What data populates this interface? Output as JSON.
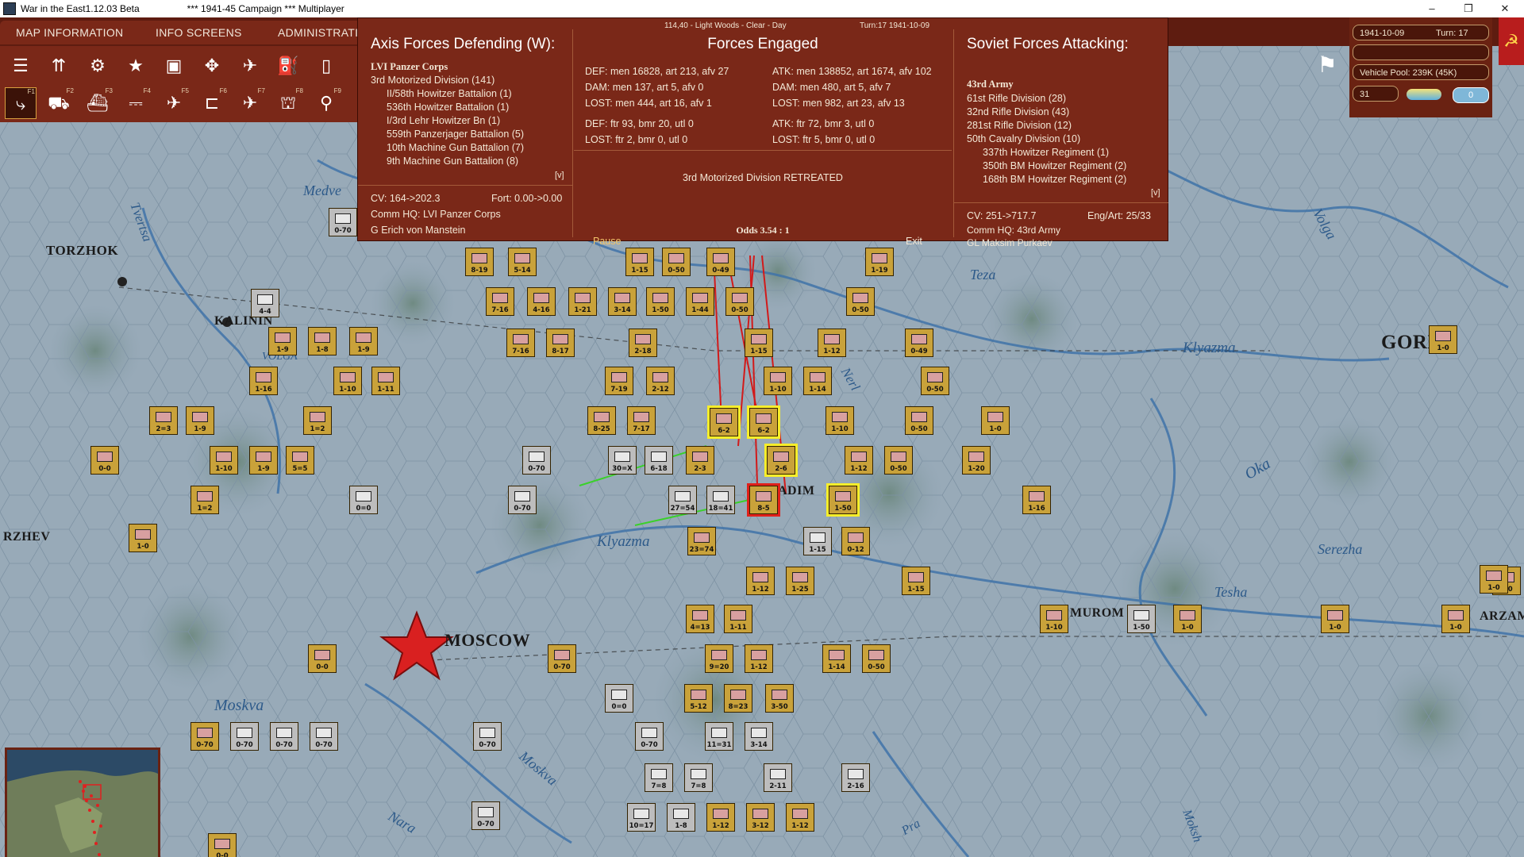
{
  "window": {
    "title": "War in the East1.12.03 Beta",
    "subtitle": "***   1941-45 Campaign   ***   Multiplayer",
    "minimize": "–",
    "maximize": "❐",
    "close": "✕"
  },
  "tabs": [
    {
      "label": "MAP INFORMATION"
    },
    {
      "label": "INFO SCREENS"
    },
    {
      "label": "ADMINISTRATI"
    }
  ],
  "toolbar": {
    "row1_icons": [
      "layers-icon",
      "units-icon",
      "gear-icon",
      "star-icon",
      "hq-icon",
      "arrows-icon",
      "bombers-icon",
      "fuel-icon",
      "report-icon"
    ],
    "row2_keys": [
      "F1",
      "F2",
      "F3",
      "F4",
      "F5",
      "F6",
      "F7",
      "F8",
      "F9"
    ]
  },
  "status": {
    "date": "1941-10-09",
    "turn": "Turn: 17",
    "vehicle_pool": "Vehicle Pool: 239K (45K)",
    "field_31": "31",
    "field_0": "0"
  },
  "combat": {
    "header_location": "114,40 - Light Woods - Clear - Day",
    "header_turn": "Turn:17  1941-10-09",
    "defender": {
      "title": "Axis Forces Defending (W):",
      "corps": "LVI Panzer Corps",
      "units": [
        "3rd Motorized Division (141)",
        "II/58th Howitzer Battalion (1)",
        "536th Howitzer Battalion (1)",
        "I/3rd Lehr Howitzer Bn (1)",
        "559th Panzerjager Battalion (5)",
        "10th Machine Gun Battalion (7)",
        "9th Machine Gun Battalion (8)"
      ],
      "toggle": "[v]",
      "cv": "CV: 164->202.3",
      "fort": "Fort: 0.00->0.00",
      "hq": "Comm HQ: LVI Panzer Corps",
      "leader": "G Erich von Manstein"
    },
    "engaged": {
      "title": "Forces Engaged",
      "def": "DEF: men 16828, art 213, afv 27",
      "dam_def": "DAM: men 137, art 5, afv 0",
      "lost_def": "LOST: men 444, art 16, afv 1",
      "def_air": "DEF: ftr 93, bmr 20, utl 0",
      "lost_def_air": "LOST: ftr 2, bmr 0, utl 0",
      "atk": "ATK: men 138852, art 1674, afv 102",
      "dam_atk": "DAM: men 480, art 5, afv 7",
      "lost_atk": "LOST: men 982, art 23, afv 13",
      "atk_air": "ATK: ftr 72, bmr 3, utl 0",
      "lost_atk_air": "LOST: ftr 5, bmr 0, utl 0",
      "result": "3rd Motorized Division RETREATED",
      "odds": "Odds 3.54 : 1",
      "pause": "Pause",
      "exit": "Exit"
    },
    "attacker": {
      "title": "Soviet Forces Attacking:",
      "army": "43rd Army",
      "units": [
        "61st Rifle Division (28)",
        "32nd Rifle Division (43)",
        "281st Rifle Division (12)",
        "50th Cavalry Division (10)",
        "337th Howitzer Regiment (1)",
        "350th BM Howitzer Regiment (2)",
        "168th BM Howitzer Regiment (2)"
      ],
      "toggle": "[v]",
      "cv": "CV: 251->717.7",
      "engart": "Eng/Art: 25/33",
      "hq": "Comm HQ: 43rd Army",
      "leader": "GL Maksim Purkaev"
    }
  },
  "map": {
    "cities": [
      "TORZHOK",
      "KALININ",
      "RZHEV",
      "MOSCOW",
      "GORKY",
      "MUROM",
      "ARZAM",
      "ADIM"
    ],
    "rivers": [
      "Medve",
      "Tvertsa",
      "VOLGA",
      "Teza",
      "Klyazma",
      "Klyazma",
      "Nerl",
      "Volga",
      "Oka",
      "Serezha",
      "Tesha",
      "Moskva",
      "Moskva",
      "Nara",
      "Pra",
      "Moksh"
    ]
  },
  "counters": [
    {
      "lbl": "0-70"
    },
    {
      "lbl": "8-19"
    },
    {
      "lbl": "5-14"
    },
    {
      "lbl": "1-15"
    },
    {
      "lbl": "0-50"
    },
    {
      "lbl": "0-49"
    },
    {
      "lbl": "1-19"
    },
    {
      "lbl": "4-4"
    },
    {
      "lbl": "7-16"
    },
    {
      "lbl": "4-16"
    },
    {
      "lbl": "1-21"
    },
    {
      "lbl": "3-14"
    },
    {
      "lbl": "1-50"
    },
    {
      "lbl": "1-44"
    },
    {
      "lbl": "0-50"
    },
    {
      "lbl": "0-50"
    },
    {
      "lbl": "1-9"
    },
    {
      "lbl": "1-8"
    },
    {
      "lbl": "1-9"
    },
    {
      "lbl": "7-16"
    },
    {
      "lbl": "8-17"
    },
    {
      "lbl": "2-18"
    },
    {
      "lbl": "1-15"
    },
    {
      "lbl": "1-12"
    },
    {
      "lbl": "0-49"
    },
    {
      "lbl": "1-16"
    },
    {
      "lbl": "1-10"
    },
    {
      "lbl": "1-11"
    },
    {
      "lbl": "7-19"
    },
    {
      "lbl": "2-12"
    },
    {
      "lbl": "1-10"
    },
    {
      "lbl": "1-14"
    },
    {
      "lbl": "0-50"
    },
    {
      "lbl": "2=3"
    },
    {
      "lbl": "1-9"
    },
    {
      "lbl": "1=2"
    },
    {
      "lbl": "8-25"
    },
    {
      "lbl": "7-17"
    },
    {
      "lbl": "6-2"
    },
    {
      "lbl": "6-2"
    },
    {
      "lbl": "1-10"
    },
    {
      "lbl": "0-50"
    },
    {
      "lbl": "1-0"
    },
    {
      "lbl": "0-0"
    },
    {
      "lbl": "1-10"
    },
    {
      "lbl": "1-9"
    },
    {
      "lbl": "5=5"
    },
    {
      "lbl": "0-70"
    },
    {
      "lbl": "30=X"
    },
    {
      "lbl": "6-18"
    },
    {
      "lbl": "2-3"
    },
    {
      "lbl": "2-6"
    },
    {
      "lbl": "1-12"
    },
    {
      "lbl": "0-50"
    },
    {
      "lbl": "1-20"
    },
    {
      "lbl": "1=2"
    },
    {
      "lbl": "0=0"
    },
    {
      "lbl": "0-70"
    },
    {
      "lbl": "27=54"
    },
    {
      "lbl": "18=41"
    },
    {
      "lbl": "8-5"
    },
    {
      "lbl": "1-50"
    },
    {
      "lbl": "1-16"
    },
    {
      "lbl": "1-0"
    },
    {
      "lbl": "23=74"
    },
    {
      "lbl": "1-15"
    },
    {
      "lbl": "0-12"
    },
    {
      "lbl": "1-12"
    },
    {
      "lbl": "1-25"
    },
    {
      "lbl": "1-15"
    },
    {
      "lbl": "1-0"
    },
    {
      "lbl": "4=13"
    },
    {
      "lbl": "1-11"
    },
    {
      "lbl": "1-10"
    },
    {
      "lbl": "1-50"
    },
    {
      "lbl": "1-0"
    },
    {
      "lbl": "1-0"
    },
    {
      "lbl": "1-0"
    },
    {
      "lbl": "0-0"
    },
    {
      "lbl": "0-70"
    },
    {
      "lbl": "9=20"
    },
    {
      "lbl": "1-12"
    },
    {
      "lbl": "1-14"
    },
    {
      "lbl": "0-50"
    },
    {
      "lbl": "0=0"
    },
    {
      "lbl": "5-12"
    },
    {
      "lbl": "8=23"
    },
    {
      "lbl": "3-50"
    },
    {
      "lbl": "0-70"
    },
    {
      "lbl": "0-70"
    },
    {
      "lbl": "0-70"
    },
    {
      "lbl": "0-70"
    },
    {
      "lbl": "0-70"
    },
    {
      "lbl": "0-70"
    },
    {
      "lbl": "11=31"
    },
    {
      "lbl": "3-14"
    },
    {
      "lbl": "7=8"
    },
    {
      "lbl": "7=8"
    },
    {
      "lbl": "2-11"
    },
    {
      "lbl": "2-16"
    },
    {
      "lbl": "0-70"
    },
    {
      "lbl": "10=17"
    },
    {
      "lbl": "1-8"
    },
    {
      "lbl": "1-12"
    },
    {
      "lbl": "3-12"
    },
    {
      "lbl": "1-12"
    },
    {
      "lbl": "0-0"
    },
    {
      "lbl": "0-0"
    },
    {
      "lbl": "1-0"
    },
    {
      "lbl": "1-0"
    }
  ]
}
